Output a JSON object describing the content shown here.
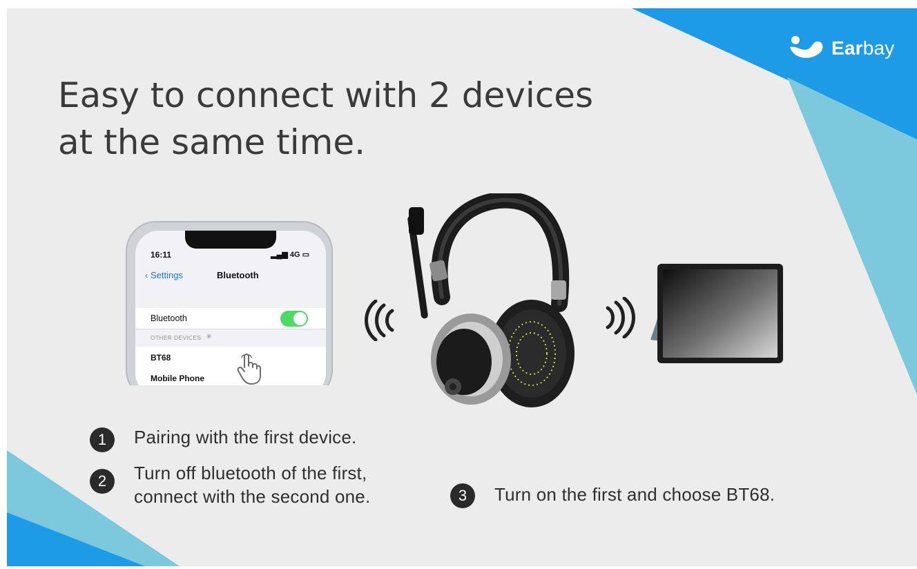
{
  "brand": {
    "name_bold": "Ear",
    "name_light": "bay",
    "accent": "#1e9be6",
    "accent_light": "#7cc9de"
  },
  "headline": {
    "line1": "Easy to connect with 2 devices",
    "line2": "at the same time."
  },
  "phone": {
    "time": "16:11",
    "network": "4G",
    "back_label": "Settings",
    "title": "Bluetooth",
    "bluetooth_label": "Bluetooth",
    "bluetooth_on": true,
    "other_devices_header": "OTHER DEVICES",
    "devices": [
      "BT68",
      "Mobile Phone"
    ]
  },
  "steps": [
    {
      "num": "1",
      "text": "Pairing with the first device."
    },
    {
      "num": "2",
      "line1": "Turn off bluetooth of the first,",
      "line2": "connect with the second one."
    },
    {
      "num": "3",
      "text": "Turn on the first and choose BT68."
    }
  ],
  "icons": [
    "earbay-logo-icon",
    "signal-waves-icon",
    "hand-pointer-icon",
    "headset-image",
    "tablet-image"
  ]
}
